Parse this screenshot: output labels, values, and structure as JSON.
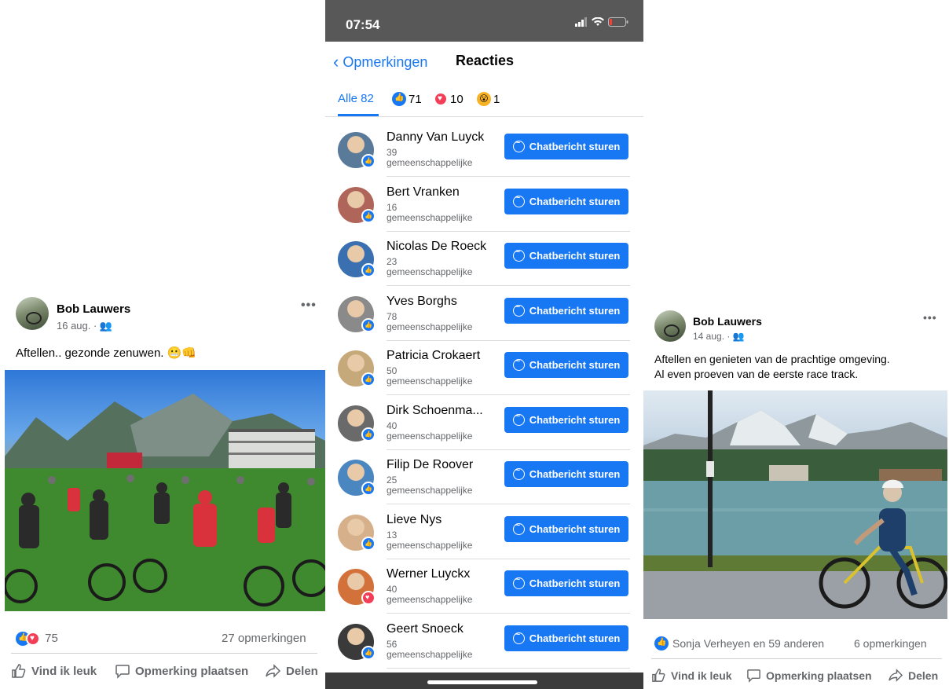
{
  "left_post": {
    "author": "Bob Lauwers",
    "date": "16 aug. · 👥",
    "more": "•••",
    "text": "Aftellen.. gezonde zenuwen. 😬👊",
    "reaction_count": "75",
    "comments": "27 opmerkingen",
    "actions": {
      "like": "Vind ik leuk",
      "comment": "Opmerking plaatsen",
      "share": "Delen"
    }
  },
  "phone": {
    "time": "07:54",
    "status_icons": "▮▮▮ ᯤ ▭",
    "back_label": "Opmerkingen",
    "title": "Reacties",
    "tabs": [
      {
        "label": "Alle 82"
      },
      {
        "label": "71"
      },
      {
        "label": "10"
      },
      {
        "label": "1"
      }
    ],
    "button_label": "Chatbericht sturen",
    "people": [
      {
        "name": "Danny Van Luyck",
        "count": "39",
        "mutual": "gemeenschappelijke",
        "reaction": "like"
      },
      {
        "name": "Bert Vranken",
        "count": "16",
        "mutual": "gemeenschappelijke",
        "reaction": "like"
      },
      {
        "name": "Nicolas De Roeck",
        "count": "23",
        "mutual": "gemeenschappelijke",
        "reaction": "like"
      },
      {
        "name": "Yves Borghs",
        "count": "78",
        "mutual": "gemeenschappelijke",
        "reaction": "like"
      },
      {
        "name": "Patricia Crokaert",
        "count": "50",
        "mutual": "gemeenschappelijke",
        "reaction": "like"
      },
      {
        "name": "Dirk Schoenma...",
        "count": "40",
        "mutual": "gemeenschappelijke",
        "reaction": "like"
      },
      {
        "name": "Filip De Roover",
        "count": "25",
        "mutual": "gemeenschappelijke",
        "reaction": "like"
      },
      {
        "name": "Lieve Nys",
        "count": "13",
        "mutual": "gemeenschappelijke",
        "reaction": "like"
      },
      {
        "name": "Werner Luyckx",
        "count": "40",
        "mutual": "gemeenschappelijke",
        "reaction": "love"
      },
      {
        "name": "Geert Snoeck",
        "count": "56",
        "mutual": "gemeenschappelijke",
        "reaction": "like"
      }
    ]
  },
  "right_post": {
    "author": "Bob Lauwers",
    "date": "14 aug. · 👥",
    "more": "•••",
    "text_line1": "Aftellen en genieten van de prachtige omgeving.",
    "text_line2": "Al even proeven van de eerste race track.",
    "reactions": "Sonja Verheyen en 59 anderen",
    "comments": "6 opmerkingen",
    "actions": {
      "like": "Vind ik leuk",
      "comment": "Opmerking plaatsen",
      "share": "Delen"
    }
  },
  "colors": {
    "accent": "#1877f2",
    "love": "#f33e58",
    "wow": "#f7b125",
    "muted": "#65676b"
  }
}
